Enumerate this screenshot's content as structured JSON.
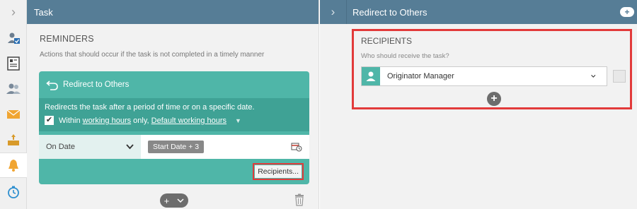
{
  "rail": {
    "expand_glyph": "›",
    "items": [
      {
        "icon": "user-check-icon"
      },
      {
        "icon": "form-icon"
      },
      {
        "icon": "users-icon"
      },
      {
        "icon": "envelope-icon"
      },
      {
        "icon": "inbox-icon"
      },
      {
        "icon": "bell-icon",
        "active": true
      },
      {
        "icon": "stopwatch-icon"
      }
    ]
  },
  "task_panel": {
    "title": "Task",
    "section_title": "REMINDERS",
    "section_desc": "Actions that should occur if the task is not completed in a timely manner",
    "card": {
      "title": "Redirect to Others",
      "description": "Redirects the task after a period of time or on a specific date.",
      "within_prefix": "Within",
      "working_hours_link": "working hours",
      "only_text": "only,",
      "default_hours_link": "Default working hours",
      "checkbox_checked": true,
      "schedule_type": "On Date",
      "date_value": "Start Date + 3",
      "recipients_button": "Recipients..."
    }
  },
  "redirect_panel": {
    "title": "Redirect to Others",
    "recipients_title": "RECIPIENTS",
    "recipients_question": "Who should receive the task?",
    "selected_recipient": "Originator Manager"
  },
  "colors": {
    "header": "#567d96",
    "card_teal": "#4fb6a8",
    "card_dark_teal": "#3fa295",
    "highlight_red": "#e23a3a"
  }
}
